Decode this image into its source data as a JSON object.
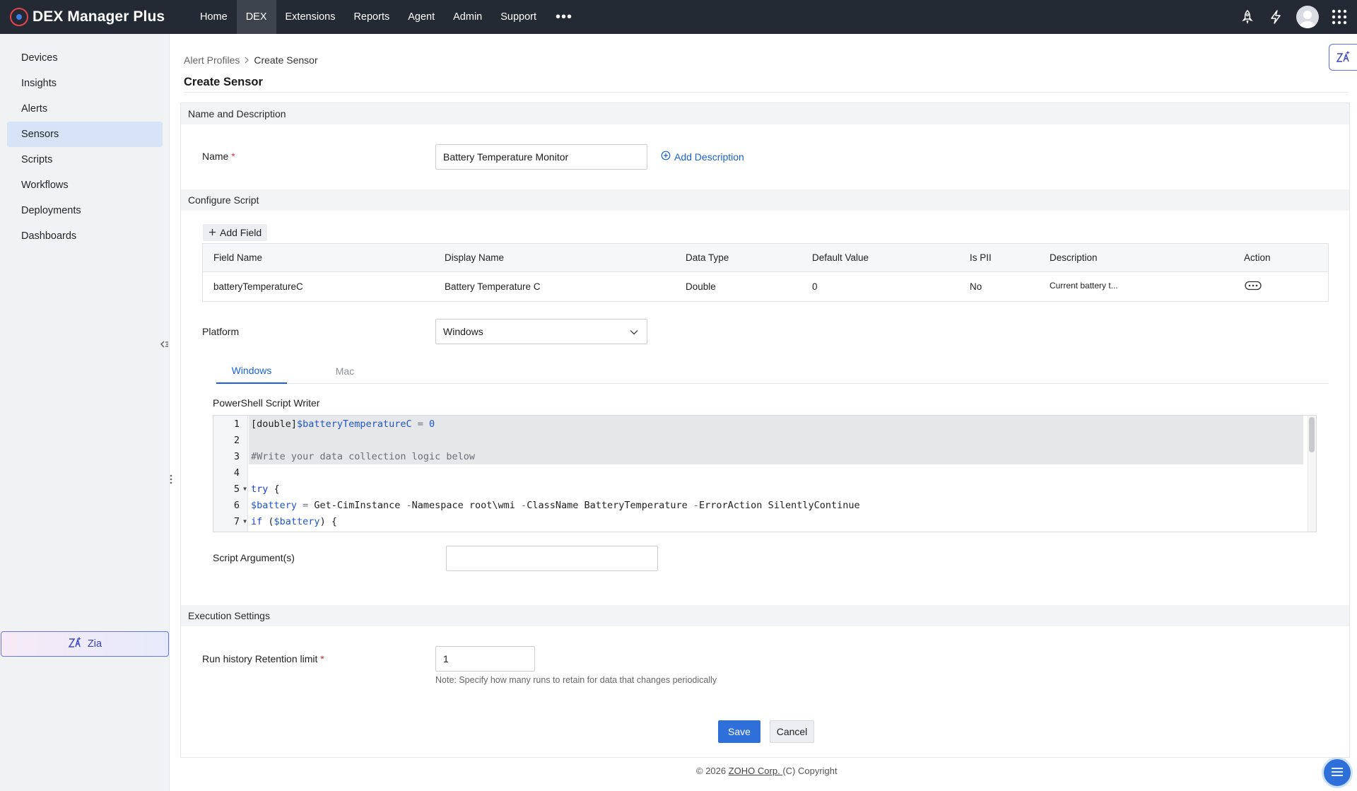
{
  "app": {
    "name": "DEX Manager Plus"
  },
  "nav": {
    "items": [
      {
        "label": "Home",
        "active": false
      },
      {
        "label": "DEX",
        "active": true
      },
      {
        "label": "Extensions",
        "active": false
      },
      {
        "label": "Reports",
        "active": false
      },
      {
        "label": "Agent",
        "active": false
      },
      {
        "label": "Admin",
        "active": false
      },
      {
        "label": "Support",
        "active": false
      }
    ],
    "more": "•••"
  },
  "top_icons": [
    "rocket-icon",
    "lightning-icon",
    "avatar",
    "apps-grid-icon"
  ],
  "sidebar": {
    "items": [
      {
        "label": "Devices",
        "active": false
      },
      {
        "label": "Insights",
        "active": false
      },
      {
        "label": "Alerts",
        "active": false
      },
      {
        "label": "Sensors",
        "active": true
      },
      {
        "label": "Scripts",
        "active": false
      },
      {
        "label": "Workflows",
        "active": false
      },
      {
        "label": "Deployments",
        "active": false
      },
      {
        "label": "Dashboards",
        "active": false
      }
    ],
    "zia_label": "Zia"
  },
  "breadcrumb": {
    "parent": "Alert Profiles",
    "current": "Create Sensor"
  },
  "page_title": "Create Sensor",
  "name_section": {
    "title": "Name and Description",
    "name_label": "Name",
    "required_mark": "*",
    "name_value": "Battery Temperature Monitor",
    "add_description": "Add Description"
  },
  "script_section": {
    "title": "Configure Script",
    "add_field": "Add Field",
    "table": {
      "headers": [
        "Field Name",
        "Display Name",
        "Data Type",
        "Default Value",
        "Is PII",
        "Description",
        "Action"
      ],
      "rows": [
        {
          "field_name": "batteryTemperatureC",
          "display_name": "Battery Temperature C",
          "data_type": "Double",
          "default_value": "0",
          "is_pii": "No",
          "description": "Current battery t..."
        }
      ]
    },
    "platform_label": "Platform",
    "platform_value": "Windows",
    "tabs": [
      {
        "label": "Windows",
        "active": true
      },
      {
        "label": "Mac",
        "active": false
      }
    ],
    "editor_label": "PowerShell Script Writer",
    "line_numbers": [
      "1",
      "2",
      "3",
      "4",
      "5",
      "6",
      "7"
    ],
    "code": {
      "l1_type": "[double]",
      "l1_var": "$batteryTemperatureC",
      "l1_eq": " = ",
      "l1_num": "0",
      "l3_comment": "#Write your data collection logic below",
      "l5_kw": "try",
      "l5_rest": " {",
      "l6_var": "$battery",
      "l6_eq": " = ",
      "l6_cmd": "Get-CimInstance ",
      "l6_p1": "-",
      "l6_p1name": "Namespace root\\wmi ",
      "l6_p2": "-",
      "l6_p2name": "ClassName BatteryTemperature ",
      "l6_p3": "-",
      "l6_p3name": "ErrorAction SilentlyContinue",
      "l7_kw": "if",
      "l7_open": " (",
      "l7_var": "$battery",
      "l7_close": ") {"
    },
    "args_label": "Script Argument(s)",
    "args_value": ""
  },
  "execution_section": {
    "title": "Execution Settings",
    "retention_label": "Run history Retention limit",
    "required_mark": "*",
    "retention_value": "1",
    "note": "Note: Specify how many runs to retain for data that changes periodically"
  },
  "actions": {
    "save": "Save",
    "cancel": "Cancel"
  },
  "footer": {
    "prefix": "© 2026 ",
    "company": "ZOHO Corp. ",
    "suffix": "(C) Copyright"
  },
  "colors": {
    "topbar": "#232a34",
    "accent": "#2f6fd9",
    "link": "#1762d6",
    "sidebar_active": "#d7e3f7",
    "required": "#e0353b"
  }
}
